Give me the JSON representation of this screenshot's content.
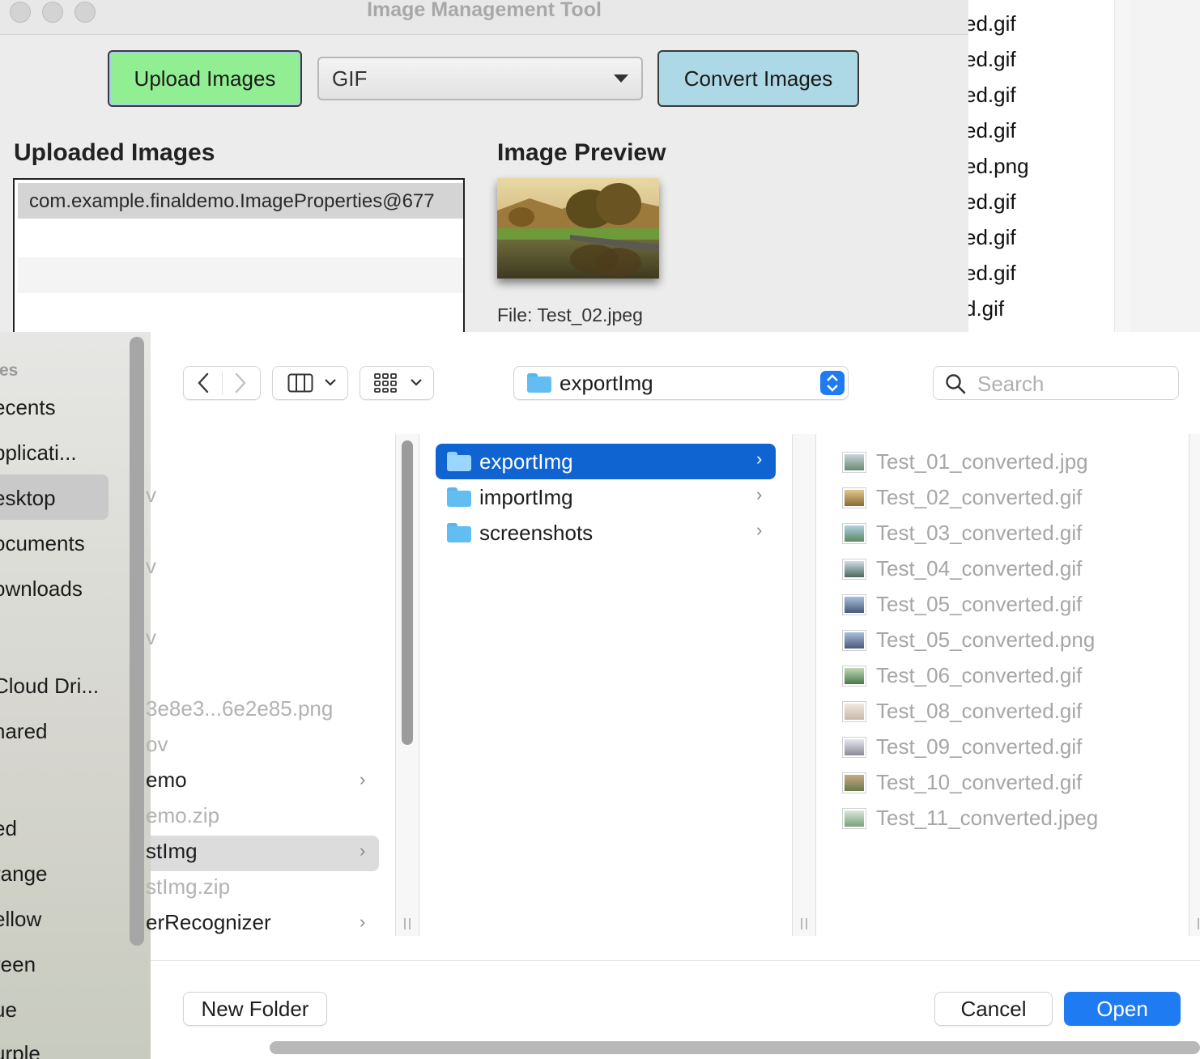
{
  "app": {
    "title": "Image Management Tool",
    "upload_label": "Upload Images",
    "format_value": "GIF",
    "convert_label": "Convert Images",
    "uploaded_heading": "Uploaded Images",
    "uploaded_item": "com.example.finaldemo.ImageProperties@677",
    "preview_heading": "Image Preview",
    "preview_file": "File: Test_02.jpeg"
  },
  "background_files": [
    "ed.gif",
    "ed.gif",
    "ed.gif",
    "ed.gif",
    "ed.png",
    "ed.gif",
    "ed.gif",
    "ed.gif",
    "d.gif"
  ],
  "sidebar": {
    "section": "tes",
    "items": [
      "ecents",
      "pplicati...",
      "esktop",
      "ocuments",
      "ownloads",
      "Cloud Dri...",
      "hared",
      "ed",
      "range",
      "ellow",
      "reen",
      "ue",
      "urple"
    ],
    "selected": "esktop"
  },
  "toolbar": {
    "path": "exportImg",
    "search_placeholder": "Search"
  },
  "column1": {
    "items": [
      "v",
      "v",
      "v",
      "3e8e3...6e2e85.png",
      "ov",
      "emo",
      "emo.zip",
      "stImg",
      "stImg.zip",
      "erRecognizer"
    ]
  },
  "column2": {
    "folders": [
      "exportImg",
      "importImg",
      "screenshots"
    ],
    "selected": "exportImg"
  },
  "column3": {
    "files": [
      "Test_01_converted.jpg",
      "Test_02_converted.gif",
      "Test_03_converted.gif",
      "Test_04_converted.gif",
      "Test_05_converted.gif",
      "Test_05_converted.png",
      "Test_06_converted.gif",
      "Test_08_converted.gif",
      "Test_09_converted.gif",
      "Test_10_converted.gif",
      "Test_11_converted.jpeg"
    ]
  },
  "footer": {
    "new_folder": "New Folder",
    "cancel": "Cancel",
    "open": "Open"
  },
  "colors": {
    "accent": "#1f7bf2",
    "selection": "#0f64d2",
    "upload_button": "#92ee92",
    "convert_button": "#add8e6"
  }
}
